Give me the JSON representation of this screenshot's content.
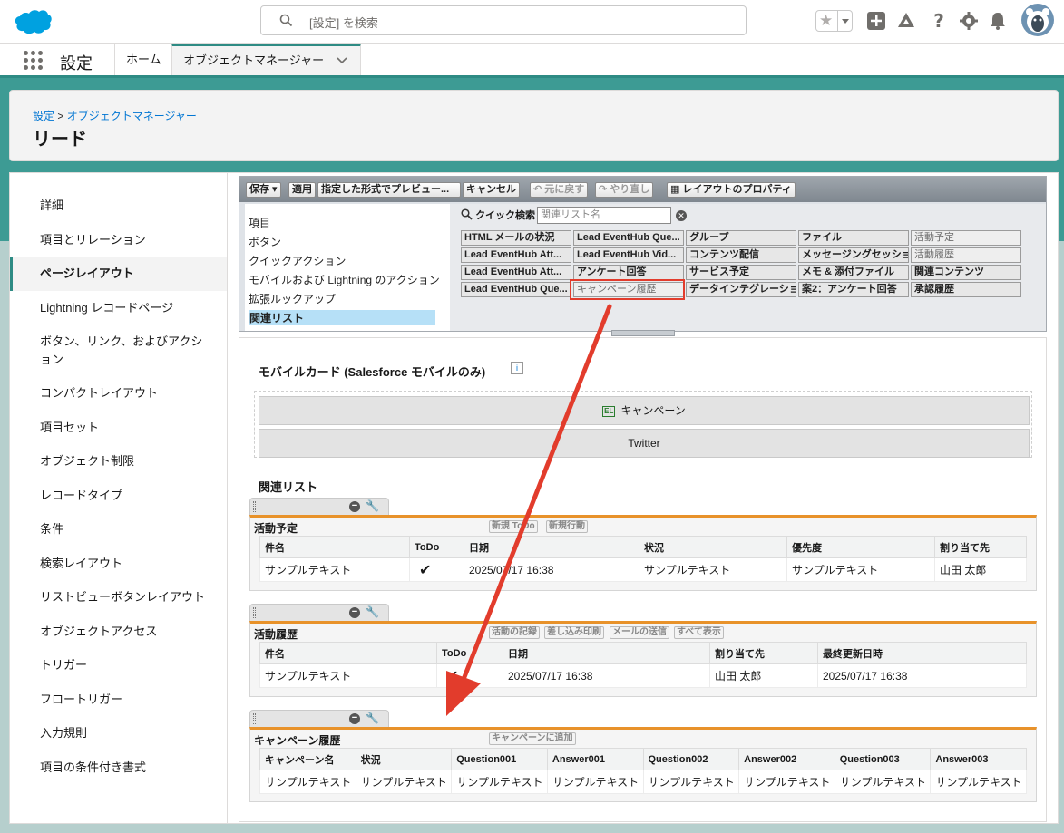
{
  "header": {
    "search_placeholder": "[設定] を検索"
  },
  "context_bar": {
    "app_name": "設定",
    "tabs": [
      {
        "label": "ホーム"
      },
      {
        "label": "オブジェクトマネージャー"
      }
    ]
  },
  "page_header": {
    "breadcrumb_root": "設定",
    "breadcrumb_separator": ">",
    "breadcrumb_current": "オブジェクトマネージャー",
    "title": "リード"
  },
  "sidebar": {
    "items": [
      {
        "label": "詳細"
      },
      {
        "label": "項目とリレーション"
      },
      {
        "label": "ページレイアウト"
      },
      {
        "label": "Lightning レコードページ"
      },
      {
        "label": "ボタン、リンク、およびアクション"
      },
      {
        "label": "コンパクトレイアウト"
      },
      {
        "label": "項目セット"
      },
      {
        "label": "オブジェクト制限"
      },
      {
        "label": "レコードタイプ"
      },
      {
        "label": "条件"
      },
      {
        "label": "検索レイアウト"
      },
      {
        "label": "リストビューボタンレイアウト"
      },
      {
        "label": "オブジェクトアクセス"
      },
      {
        "label": "トリガー"
      },
      {
        "label": "フロートリガー"
      },
      {
        "label": "入力規則"
      },
      {
        "label": "項目の条件付き書式"
      }
    ]
  },
  "toolbar": {
    "save": "保存",
    "apply": "適用",
    "preview": "指定した形式でプレビュー...",
    "cancel": "キャンセル",
    "undo": "元に戻す",
    "redo": "やり直し",
    "layout_properties": "レイアウトのプロパティ"
  },
  "palette": {
    "categories": [
      {
        "label": "項目"
      },
      {
        "label": "ボタン"
      },
      {
        "label": "クイックアクション"
      },
      {
        "label": "モバイルおよび Lightning のアクション"
      },
      {
        "label": "拡張ルックアップ"
      },
      {
        "label": "関連リスト"
      }
    ],
    "quick_search_label": "クイック検索",
    "quick_search_placeholder": "関連リスト名",
    "items": [
      {
        "label": "HTML メールの状況"
      },
      {
        "label": "Lead EventHub Que..."
      },
      {
        "label": "グループ"
      },
      {
        "label": "ファイル"
      },
      {
        "label": "活動予定"
      },
      {
        "label": "Lead EventHub Att..."
      },
      {
        "label": "Lead EventHub Vid..."
      },
      {
        "label": "コンテンツ配信"
      },
      {
        "label": "メッセージングセッション"
      },
      {
        "label": "活動履歴"
      },
      {
        "label": "Lead EventHub Att..."
      },
      {
        "label": "アンケート回答"
      },
      {
        "label": "サービス予定"
      },
      {
        "label": "メモ & 添付ファイル"
      },
      {
        "label": "関連コンテンツ"
      },
      {
        "label": "Lead EventHub Que..."
      },
      {
        "label": "キャンペーン履歴"
      },
      {
        "label": "データインテグレーション"
      },
      {
        "label": "案2：アンケート回答"
      },
      {
        "label": "承認履歴"
      }
    ]
  },
  "mobile_cards": {
    "title": "モバイルカード (Salesforce モバイルのみ)",
    "info_icon": "i",
    "items": [
      {
        "label": "キャンペーン",
        "icon": "EL"
      },
      {
        "label": "Twitter"
      }
    ]
  },
  "related_lists": {
    "title": "関連リスト",
    "lists": [
      {
        "name": "活動予定",
        "buttons": [
          "新規 ToDo",
          "新規行動"
        ],
        "columns": [
          "件名",
          "ToDo",
          "日期",
          "状況",
          "優先度",
          "割り当て先"
        ],
        "row": [
          "サンプルテキスト",
          "✔",
          "2025/07/17 16:38",
          "サンプルテキスト",
          "サンプルテキスト",
          "山田 太郎"
        ]
      },
      {
        "name": "活動履歴",
        "buttons": [
          "活動の記録",
          "差し込み印刷",
          "メールの送信",
          "すべて表示"
        ],
        "columns": [
          "件名",
          "ToDo",
          "日期",
          "割り当て先",
          "最終更新日時"
        ],
        "row": [
          "サンプルテキスト",
          "✔",
          "2025/07/17 16:38",
          "山田 太郎",
          "2025/07/17 16:38"
        ]
      },
      {
        "name": "キャンペーン履歴",
        "buttons": [
          "キャンペーンに追加"
        ],
        "columns": [
          "キャンペーン名",
          "状況",
          "Question001",
          "Answer001",
          "Question002",
          "Answer002",
          "Question003",
          "Answer003"
        ],
        "row": [
          "サンプルテキスト",
          "サンプルテキスト",
          "サンプルテキスト",
          "サンプルテキスト",
          "サンプルテキスト",
          "サンプルテキスト",
          "サンプルテキスト",
          "サンプルテキスト"
        ]
      }
    ]
  },
  "colors": {
    "brand": "#00a1e0",
    "accent": "#2e8b84",
    "highlight": "#e23c2c",
    "related_list_bar": "#e8922a"
  }
}
